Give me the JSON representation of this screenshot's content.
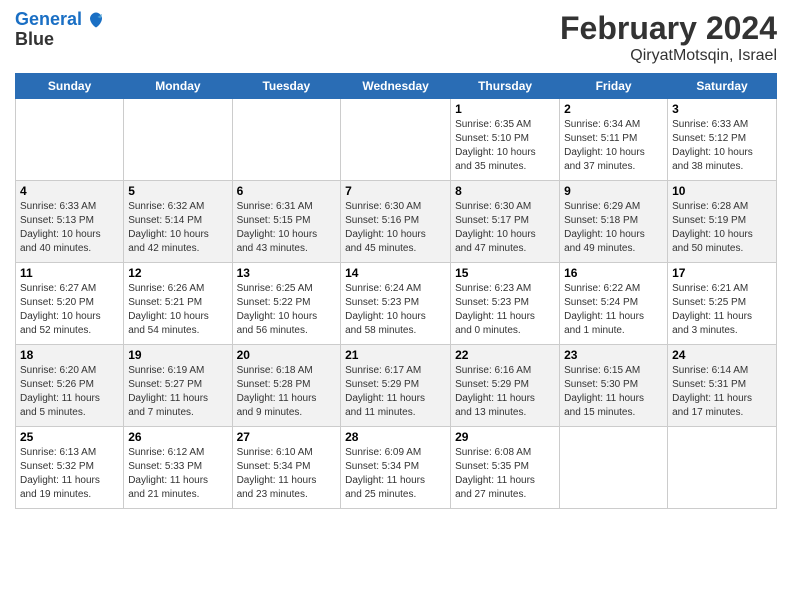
{
  "logo": {
    "line1": "General",
    "line2": "Blue"
  },
  "title": "February 2024",
  "subtitle": "QiryatMotsqin, Israel",
  "days_of_week": [
    "Sunday",
    "Monday",
    "Tuesday",
    "Wednesday",
    "Thursday",
    "Friday",
    "Saturday"
  ],
  "weeks": [
    [
      {
        "day": "",
        "info": ""
      },
      {
        "day": "",
        "info": ""
      },
      {
        "day": "",
        "info": ""
      },
      {
        "day": "",
        "info": ""
      },
      {
        "day": "1",
        "info": "Sunrise: 6:35 AM\nSunset: 5:10 PM\nDaylight: 10 hours\nand 35 minutes."
      },
      {
        "day": "2",
        "info": "Sunrise: 6:34 AM\nSunset: 5:11 PM\nDaylight: 10 hours\nand 37 minutes."
      },
      {
        "day": "3",
        "info": "Sunrise: 6:33 AM\nSunset: 5:12 PM\nDaylight: 10 hours\nand 38 minutes."
      }
    ],
    [
      {
        "day": "4",
        "info": "Sunrise: 6:33 AM\nSunset: 5:13 PM\nDaylight: 10 hours\nand 40 minutes."
      },
      {
        "day": "5",
        "info": "Sunrise: 6:32 AM\nSunset: 5:14 PM\nDaylight: 10 hours\nand 42 minutes."
      },
      {
        "day": "6",
        "info": "Sunrise: 6:31 AM\nSunset: 5:15 PM\nDaylight: 10 hours\nand 43 minutes."
      },
      {
        "day": "7",
        "info": "Sunrise: 6:30 AM\nSunset: 5:16 PM\nDaylight: 10 hours\nand 45 minutes."
      },
      {
        "day": "8",
        "info": "Sunrise: 6:30 AM\nSunset: 5:17 PM\nDaylight: 10 hours\nand 47 minutes."
      },
      {
        "day": "9",
        "info": "Sunrise: 6:29 AM\nSunset: 5:18 PM\nDaylight: 10 hours\nand 49 minutes."
      },
      {
        "day": "10",
        "info": "Sunrise: 6:28 AM\nSunset: 5:19 PM\nDaylight: 10 hours\nand 50 minutes."
      }
    ],
    [
      {
        "day": "11",
        "info": "Sunrise: 6:27 AM\nSunset: 5:20 PM\nDaylight: 10 hours\nand 52 minutes."
      },
      {
        "day": "12",
        "info": "Sunrise: 6:26 AM\nSunset: 5:21 PM\nDaylight: 10 hours\nand 54 minutes."
      },
      {
        "day": "13",
        "info": "Sunrise: 6:25 AM\nSunset: 5:22 PM\nDaylight: 10 hours\nand 56 minutes."
      },
      {
        "day": "14",
        "info": "Sunrise: 6:24 AM\nSunset: 5:23 PM\nDaylight: 10 hours\nand 58 minutes."
      },
      {
        "day": "15",
        "info": "Sunrise: 6:23 AM\nSunset: 5:23 PM\nDaylight: 11 hours\nand 0 minutes."
      },
      {
        "day": "16",
        "info": "Sunrise: 6:22 AM\nSunset: 5:24 PM\nDaylight: 11 hours\nand 1 minute."
      },
      {
        "day": "17",
        "info": "Sunrise: 6:21 AM\nSunset: 5:25 PM\nDaylight: 11 hours\nand 3 minutes."
      }
    ],
    [
      {
        "day": "18",
        "info": "Sunrise: 6:20 AM\nSunset: 5:26 PM\nDaylight: 11 hours\nand 5 minutes."
      },
      {
        "day": "19",
        "info": "Sunrise: 6:19 AM\nSunset: 5:27 PM\nDaylight: 11 hours\nand 7 minutes."
      },
      {
        "day": "20",
        "info": "Sunrise: 6:18 AM\nSunset: 5:28 PM\nDaylight: 11 hours\nand 9 minutes."
      },
      {
        "day": "21",
        "info": "Sunrise: 6:17 AM\nSunset: 5:29 PM\nDaylight: 11 hours\nand 11 minutes."
      },
      {
        "day": "22",
        "info": "Sunrise: 6:16 AM\nSunset: 5:29 PM\nDaylight: 11 hours\nand 13 minutes."
      },
      {
        "day": "23",
        "info": "Sunrise: 6:15 AM\nSunset: 5:30 PM\nDaylight: 11 hours\nand 15 minutes."
      },
      {
        "day": "24",
        "info": "Sunrise: 6:14 AM\nSunset: 5:31 PM\nDaylight: 11 hours\nand 17 minutes."
      }
    ],
    [
      {
        "day": "25",
        "info": "Sunrise: 6:13 AM\nSunset: 5:32 PM\nDaylight: 11 hours\nand 19 minutes."
      },
      {
        "day": "26",
        "info": "Sunrise: 6:12 AM\nSunset: 5:33 PM\nDaylight: 11 hours\nand 21 minutes."
      },
      {
        "day": "27",
        "info": "Sunrise: 6:10 AM\nSunset: 5:34 PM\nDaylight: 11 hours\nand 23 minutes."
      },
      {
        "day": "28",
        "info": "Sunrise: 6:09 AM\nSunset: 5:34 PM\nDaylight: 11 hours\nand 25 minutes."
      },
      {
        "day": "29",
        "info": "Sunrise: 6:08 AM\nSunset: 5:35 PM\nDaylight: 11 hours\nand 27 minutes."
      },
      {
        "day": "",
        "info": ""
      },
      {
        "day": "",
        "info": ""
      }
    ]
  ]
}
